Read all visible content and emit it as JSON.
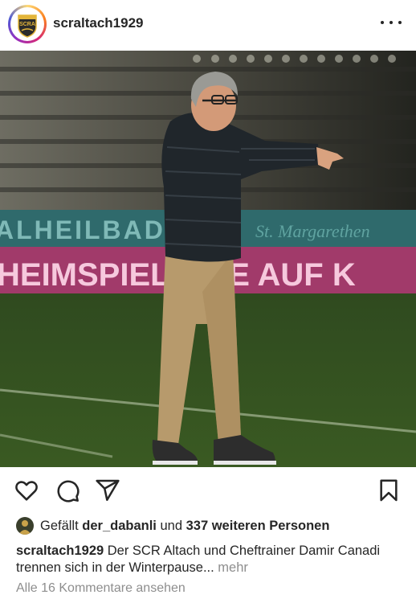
{
  "post": {
    "username": "scraltach1929",
    "avatar_icon": "scr-altach-crest-icon",
    "avatar_text": "SCRA",
    "more_icon": "more-horizontal-icon"
  },
  "photo": {
    "banner_top": "ALHEILBAD",
    "banner_top_right": "St. Margarethen",
    "banner_bottom": "HEIMSPIEL LIVE AUF K"
  },
  "actions": {
    "like_icon": "heart-icon",
    "comment_icon": "comment-icon",
    "share_icon": "paper-plane-icon",
    "save_icon": "bookmark-icon"
  },
  "likes": {
    "prefix": "Gefällt ",
    "user": "der_dabanli",
    "middle": " und ",
    "count": "337 weiteren Personen"
  },
  "caption": {
    "username": "scraltach1929",
    "text": " Der SCR Altach und Cheftrainer Damir Canadi trennen sich in der Winterpause...",
    "more": " mehr"
  },
  "comments": {
    "label": "Alle 16 Kommentare ansehen"
  },
  "colors": {
    "text": "#262626",
    "secondary": "#8e8e8e",
    "brand_gold": "#e3b53a"
  }
}
